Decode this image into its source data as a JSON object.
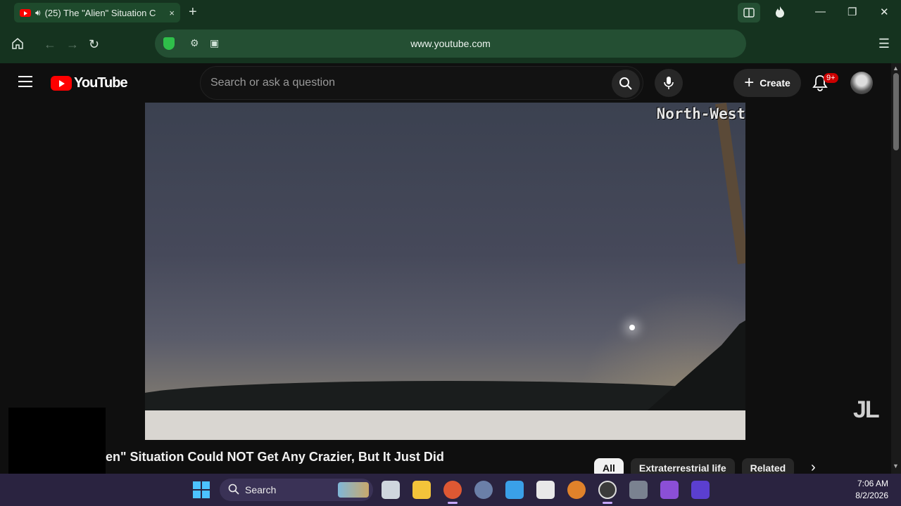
{
  "browser": {
    "tab_title": "(25) The \"Alien\" Situation C",
    "tab_close": "×",
    "new_tab": "+",
    "url": "www.youtube.com",
    "window": {
      "minimize": "—",
      "restore": "❐",
      "close": "✕"
    }
  },
  "youtube": {
    "logo_text": "YouTube",
    "search_placeholder": "Search or ask a question",
    "create_label": "Create",
    "create_plus": "+",
    "notifications_badge": "9+",
    "video": {
      "overlay_text": "North-West",
      "watermark": "JL",
      "title": "en\" Situation Could NOT Get Any Crazier, But It Just Did"
    },
    "chips": [
      {
        "label": "All",
        "active": true
      },
      {
        "label": "Extraterrestrial life",
        "active": false
      },
      {
        "label": "Related",
        "active": false
      }
    ]
  },
  "taskbar": {
    "search_label": "Search",
    "time": "7:06 AM",
    "date": "8/2/2026"
  },
  "colors": {
    "browser_chrome": "#15331f",
    "youtube_bg": "#0f0f0f",
    "youtube_red": "#ff0000",
    "taskbar": "#2a2340"
  }
}
